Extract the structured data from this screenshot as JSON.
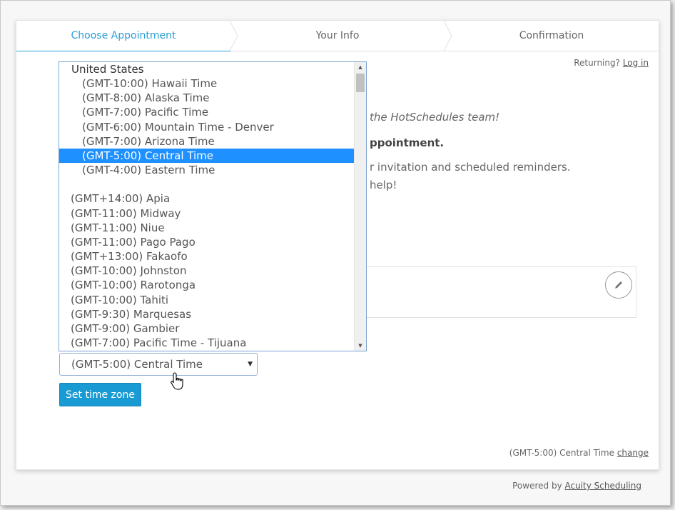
{
  "steps": {
    "step1": "Choose Appointment",
    "step2": "Your Info",
    "step3": "Confirmation"
  },
  "header": {
    "returning_label": "Returning?",
    "login_link": "Log in"
  },
  "background_text": {
    "line1": "the HotSchedules team!",
    "line2": "ppointment.",
    "line3": "r invitation and scheduled reminders.",
    "line4": "help!"
  },
  "timezone_dropdown": {
    "group_label": "United States",
    "us_options": [
      "(GMT-10:00) Hawaii Time",
      "(GMT-8:00) Alaska Time",
      "(GMT-7:00) Pacific Time",
      "(GMT-6:00) Mountain Time - Denver",
      "(GMT-7:00) Arizona Time",
      "(GMT-5:00) Central Time",
      "(GMT-4:00) Eastern Time"
    ],
    "other_options": [
      "(GMT+14:00) Apia",
      "(GMT-11:00) Midway",
      "(GMT-11:00) Niue",
      "(GMT-11:00) Pago Pago",
      "(GMT+13:00) Fakaofo",
      "(GMT-10:00) Johnston",
      "(GMT-10:00) Rarotonga",
      "(GMT-10:00) Tahiti",
      "(GMT-9:30) Marquesas",
      "(GMT-9:00) Gambier",
      "(GMT-7:00) Pacific Time - Tijuana"
    ],
    "selected_value": "(GMT-5:00) Central Time"
  },
  "set_button_label": "Set time zone",
  "footer": {
    "current_tz": "(GMT-5:00) Central Time",
    "change_link": "change"
  },
  "powered": {
    "label": "Powered by",
    "link": "Acuity Scheduling"
  },
  "colors": {
    "accent": "#2a9fd6",
    "button": "#1a9ad3",
    "highlight": "#1e90ff"
  }
}
